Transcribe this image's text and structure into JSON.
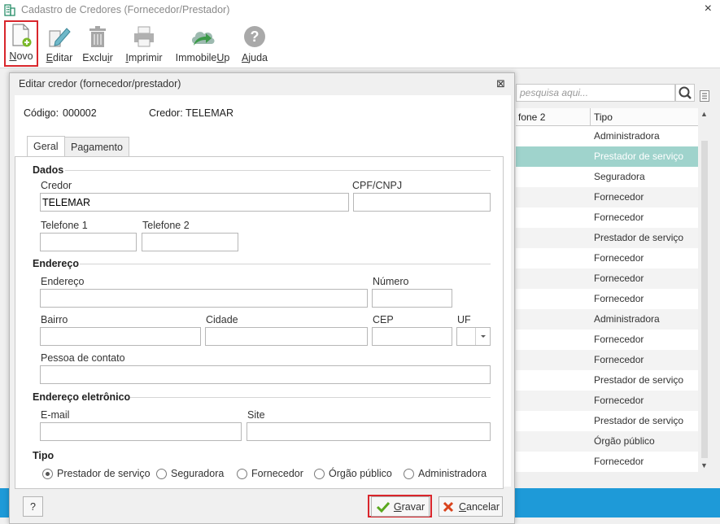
{
  "window": {
    "title": "Cadastro de Credores (Fornecedor/Prestador)",
    "close": "×"
  },
  "toolbar": {
    "novo": {
      "first": "N",
      "rest": "ovo"
    },
    "editar": {
      "first": "E",
      "rest": "ditar"
    },
    "excluir": {
      "pre": "Exclu",
      "u": "i",
      "post": "r"
    },
    "imprimir": {
      "first": "I",
      "rest": "mprimir"
    },
    "immobileup": {
      "pre": "Immobile",
      "u": "U",
      "post": "p"
    },
    "ajuda": {
      "first": "A",
      "rest": "juda"
    }
  },
  "grid": {
    "search_placeholder": "pesquisa aqui...",
    "headers": [
      "fone 2",
      "Tipo"
    ],
    "rows": [
      "Administradora",
      "Prestador de serviço",
      "Seguradora",
      "Fornecedor",
      "Fornecedor",
      "Prestador de serviço",
      "Fornecedor",
      "Fornecedor",
      "Fornecedor",
      "Administradora",
      "Fornecedor",
      "Fornecedor",
      "Prestador de serviço",
      "Fornecedor",
      "Prestador de serviço",
      "Órgão público",
      "Fornecedor"
    ],
    "selected_index": 1,
    "selected_color": "#9fd3cc"
  },
  "dialog": {
    "title": "Editar credor (fornecedor/prestador)",
    "close": "⊠",
    "codigo_label": "Código:",
    "codigo_value": "000002",
    "credor_label": "Credor:",
    "credor_value": "TELEMAR",
    "tabs": [
      "Geral",
      "Pagamento"
    ],
    "sections": {
      "dados": "Dados",
      "endereco": "Endereço",
      "endereco_eletronico": "Endereço eletrônico",
      "tipo": "Tipo"
    },
    "fields": {
      "credor": {
        "label": "Credor",
        "value": "TELEMAR"
      },
      "cpf_cnpj": {
        "label": "CPF/CNPJ",
        "value": ""
      },
      "telefone1": {
        "label": "Telefone 1",
        "value": ""
      },
      "telefone2": {
        "label": "Telefone 2",
        "value": ""
      },
      "endereco": {
        "label": "Endereço",
        "value": ""
      },
      "numero": {
        "label": "Número",
        "value": ""
      },
      "bairro": {
        "label": "Bairro",
        "value": ""
      },
      "cidade": {
        "label": "Cidade",
        "value": ""
      },
      "cep": {
        "label": "CEP",
        "value": ""
      },
      "uf": {
        "label": "UF",
        "value": ""
      },
      "pessoa_contato": {
        "label": "Pessoa de contato",
        "value": ""
      },
      "email": {
        "label": "E-mail",
        "value": ""
      },
      "site": {
        "label": "Site",
        "value": ""
      }
    },
    "tipo_options": [
      "Prestador de serviço",
      "Seguradora",
      "Fornecedor",
      "Órgão público",
      "Administradora"
    ],
    "tipo_selected": "Prestador de serviço",
    "help": "?",
    "gravar": {
      "first": "G",
      "rest": "ravar"
    },
    "cancelar": {
      "first": "C",
      "rest": "ancelar"
    }
  },
  "colors": {
    "accent": "#1e9ad8",
    "highlight": "#d9262c",
    "gravar_check": "#5aa81e",
    "cancel_x": "#d9431c"
  }
}
